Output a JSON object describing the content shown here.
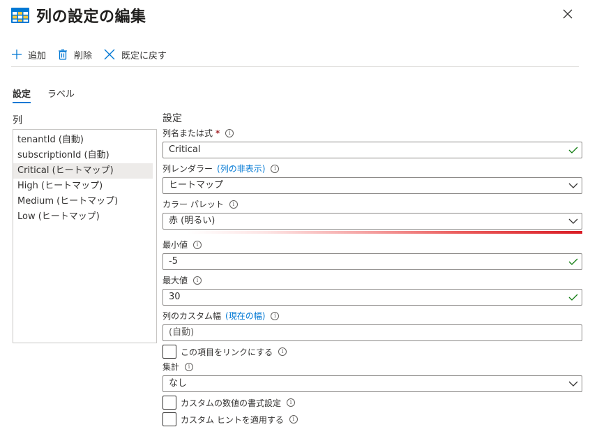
{
  "header": {
    "title": "列の設定の編集"
  },
  "toolbar": {
    "add_label": "追加",
    "delete_label": "削除",
    "reset_label": "既定に戻す"
  },
  "tabs": [
    {
      "label": "設定"
    },
    {
      "label": "ラベル"
    }
  ],
  "columns": {
    "label": "列",
    "items": [
      "tenantId (自動)",
      "subscriptionId (自動)",
      "Critical (ヒートマップ)",
      "High (ヒートマップ)",
      "Medium (ヒートマップ)",
      "Low (ヒートマップ)"
    ],
    "selected_index": 2
  },
  "settings": {
    "title": "設定",
    "column_name": {
      "label": "列名または式",
      "required_mark": "*",
      "value": "Critical"
    },
    "renderer": {
      "label": "列レンダラー",
      "link": "(列の非表示)",
      "value": "ヒートマップ"
    },
    "palette": {
      "label": "カラー パレット",
      "value": "赤 (明るい)"
    },
    "min": {
      "label": "最小値",
      "value": "-5"
    },
    "max": {
      "label": "最大値",
      "value": "30"
    },
    "width": {
      "label": "列のカスタム幅",
      "link": "(現在の幅)",
      "placeholder": "(自動)"
    },
    "link_checkbox": {
      "label": "この項目をリンクにする"
    },
    "aggregation": {
      "label": "集計",
      "value": "なし"
    },
    "number_format_checkbox": {
      "label": "カスタムの数値の書式設定"
    },
    "hint_checkbox": {
      "label": "カスタム ヒントを適用する"
    }
  },
  "colors": {
    "accent": "#0078d4",
    "success": "#107c10",
    "required": "#a4262c",
    "gradient_end": "#d91c25"
  }
}
